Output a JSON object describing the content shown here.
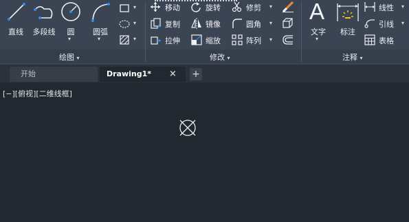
{
  "draw_panel": {
    "line_label": "直线",
    "polyline_label": "多段线",
    "circle_label": "圆",
    "arc_label": "圆弧",
    "title": "绘图"
  },
  "modify_panel": {
    "move_label": "移动",
    "rotate_label": "旋转",
    "trim_label": "修剪",
    "copy_label": "复制",
    "mirror_label": "镜像",
    "fillet_label": "圆角",
    "stretch_label": "拉伸",
    "scale_label": "缩放",
    "array_label": "阵列",
    "title": "修改"
  },
  "annotation_panel": {
    "text_label": "文字",
    "dimension_label": "标注",
    "linear_label": "线性",
    "leader_label": "引线",
    "table_label": "表格",
    "title": "注释"
  },
  "tabs": {
    "start_label": "开始",
    "drawing_label": "Drawing1*"
  },
  "viewport": {
    "controls_label": "[−][俯视][二维线框]"
  },
  "colors": {
    "ribbon_bg": "#3b4453",
    "canvas_bg": "#212830",
    "icon_accent": "#2f8ee6",
    "eraser_accent": "#e58a3c"
  }
}
